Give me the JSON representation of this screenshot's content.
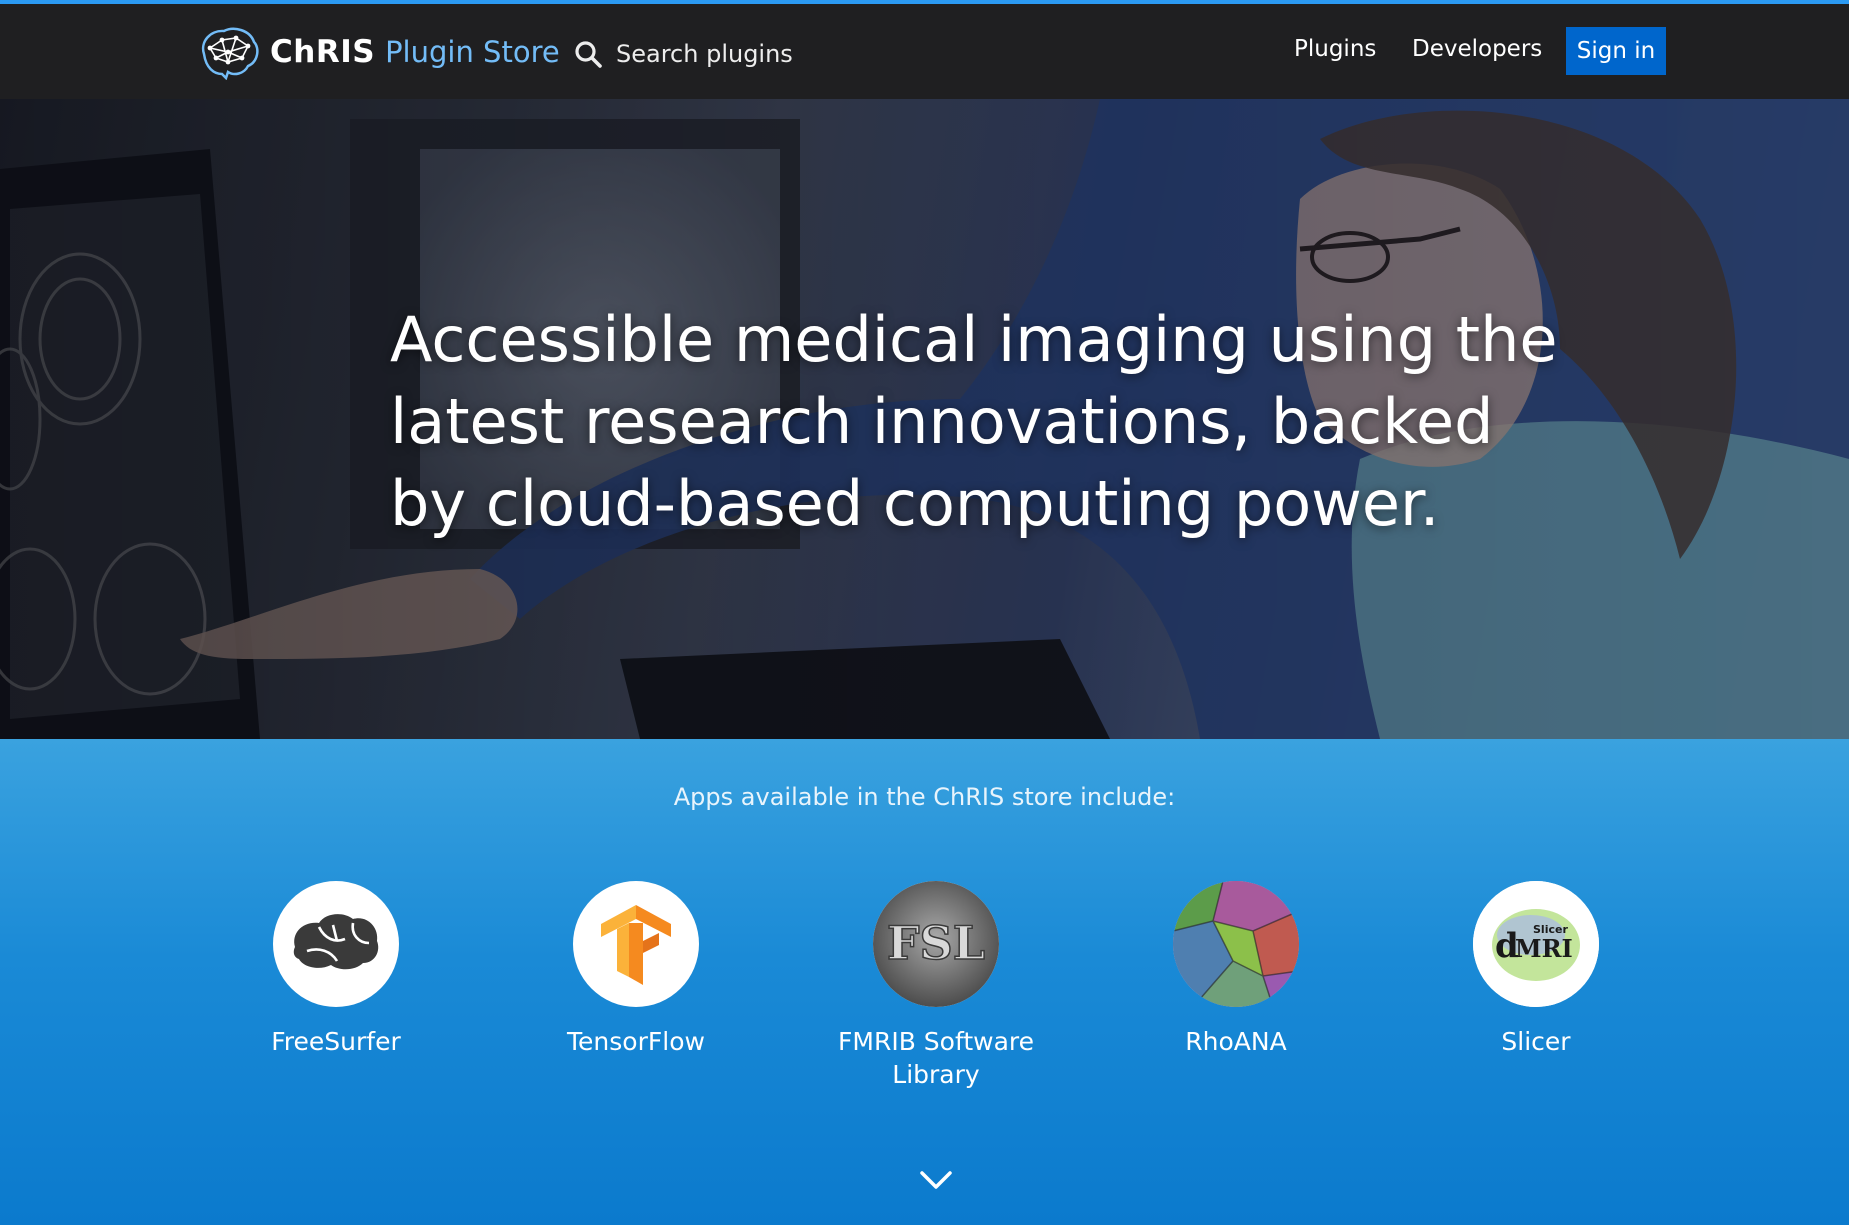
{
  "header": {
    "brand_name": "ChRIS",
    "brand_suffix": "Plugin Store",
    "search_label": "Search plugins",
    "nav": [
      "Plugins",
      "Developers"
    ],
    "signin_label": "Sign in",
    "logo_icon": "brain-network-icon",
    "search_icon": "search-icon"
  },
  "hero": {
    "title": "Accessible medical imaging using the latest research innovations, backed by cloud-based computing power."
  },
  "apps": {
    "heading": "Apps available in the ChRIS store include:",
    "items": [
      {
        "name": "FreeSurfer",
        "icon": "brain-icon"
      },
      {
        "name": "TensorFlow",
        "icon": "tensorflow-logo-icon"
      },
      {
        "name": "FMRIB Software Library",
        "icon": "fsl-logo-icon"
      },
      {
        "name": "RhoANA",
        "icon": "rhoana-logo-icon"
      },
      {
        "name": "Slicer",
        "icon": "dmri-slicer-logo-icon"
      }
    ],
    "more_icon": "chevron-down-icon"
  },
  "colors": {
    "topline": "#2b9af3",
    "header_bg": "#1f1f21",
    "brand_accent": "#73bcf7",
    "signin_bg": "#0066cc",
    "apps_bg_top": "#3aa2df",
    "apps_bg_bottom": "#0b7acd"
  }
}
